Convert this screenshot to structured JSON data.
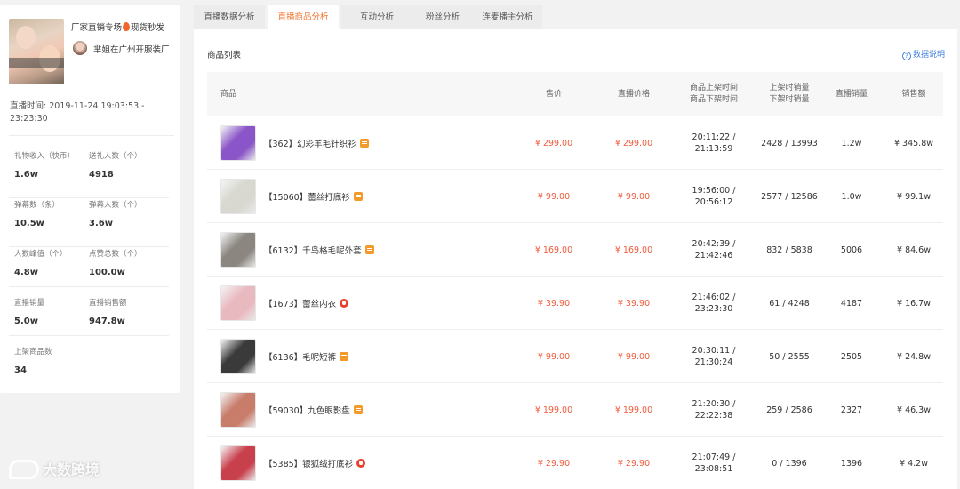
{
  "streamer": {
    "room_title": "厂家直销专场",
    "room_title_suffix": "现货秒发",
    "host_name": "芈姐在广州开服装厂",
    "live_time_label": "直播时间:",
    "live_time_value": "2019-11-24 19:03:53 - 23:23:30"
  },
  "stats": [
    {
      "label": "礼物收入（快币）",
      "value": "1.6w"
    },
    {
      "label": "送礼人数（个）",
      "value": "4918"
    },
    {
      "label": "弹幕数（条）",
      "value": "10.5w"
    },
    {
      "label": "弹幕人数（个）",
      "value": "3.6w"
    },
    {
      "label": "人数峰值（个）",
      "value": "4.8w"
    },
    {
      "label": "点赞总数（个）",
      "value": "100.0w"
    },
    {
      "label": "直播销量",
      "value": "5.0w"
    },
    {
      "label": "直播销售额",
      "value": "947.8w"
    },
    {
      "label": "上架商品数",
      "value": "34"
    }
  ],
  "tabs": [
    {
      "label": "直播数据分析",
      "active": false
    },
    {
      "label": "直播商品分析",
      "active": true
    },
    {
      "label": "互动分析",
      "active": false
    },
    {
      "label": "粉丝分析",
      "active": false
    },
    {
      "label": "连麦播主分析",
      "active": false
    }
  ],
  "list": {
    "title": "商品列表",
    "help": "数据说明",
    "help_icon": "?",
    "headers": {
      "product": "商品",
      "price": "售价",
      "live_price": "直播价格",
      "time_up": "商品上架时间",
      "time_down": "商品下架时间",
      "sales_up": "上架时销量",
      "sales_down": "下架时销量",
      "live_sales": "直播销量",
      "revenue": "销售额"
    },
    "rows": [
      {
        "name": "【362】幻彩羊毛针织衫",
        "badge": "tag",
        "price": "¥ 299.00",
        "live_price": "¥ 299.00",
        "t1": "20:11:22 /",
        "t2": "21:13:59",
        "sales": "2428 / 13993",
        "live_sales": "1.2w",
        "revenue": "¥ 345.8w",
        "thumb": "#8a55c8"
      },
      {
        "name": "【15060】蕾丝打底衫",
        "badge": "tag",
        "price": "¥ 99.00",
        "live_price": "¥ 99.00",
        "t1": "19:56:00 /",
        "t2": "20:56:12",
        "sales": "2577 / 12586",
        "live_sales": "1.0w",
        "revenue": "¥ 99.1w",
        "thumb": "#d8d8d0"
      },
      {
        "name": "【6132】千鸟格毛呢外套",
        "badge": "tag",
        "price": "¥ 169.00",
        "live_price": "¥ 169.00",
        "t1": "20:42:39 /",
        "t2": "21:42:46",
        "sales": "832 / 5838",
        "live_sales": "5006",
        "revenue": "¥ 84.6w",
        "thumb": "#8b8680"
      },
      {
        "name": "【1673】蕾丝内衣",
        "badge": "hot",
        "price": "¥ 39.90",
        "live_price": "¥ 39.90",
        "t1": "21:46:02 /",
        "t2": "23:23:30",
        "sales": "61 / 4248",
        "live_sales": "4187",
        "revenue": "¥ 16.7w",
        "thumb": "#e9b9c0"
      },
      {
        "name": "【6136】毛呢短裤",
        "badge": "tag",
        "price": "¥ 99.00",
        "live_price": "¥ 99.00",
        "t1": "20:30:11 /",
        "t2": "21:30:24",
        "sales": "50 / 2555",
        "live_sales": "2505",
        "revenue": "¥ 24.8w",
        "thumb": "#3a3a3a"
      },
      {
        "name": "【59030】九色眼影盘",
        "badge": "tag",
        "price": "¥ 199.00",
        "live_price": "¥ 199.00",
        "t1": "21:20:30 /",
        "t2": "22:22:38",
        "sales": "259 / 2586",
        "live_sales": "2327",
        "revenue": "¥ 46.3w",
        "thumb": "#c87c6a"
      },
      {
        "name": "【5385】银狐绒打底衫",
        "badge": "hot",
        "price": "¥ 29.90",
        "live_price": "¥ 29.90",
        "t1": "21:07:49 /",
        "t2": "23:08:51",
        "sales": "0 / 1396",
        "live_sales": "1396",
        "revenue": "¥ 4.2w",
        "thumb": "#c9404d"
      }
    ]
  },
  "watermark": "大数跨境"
}
